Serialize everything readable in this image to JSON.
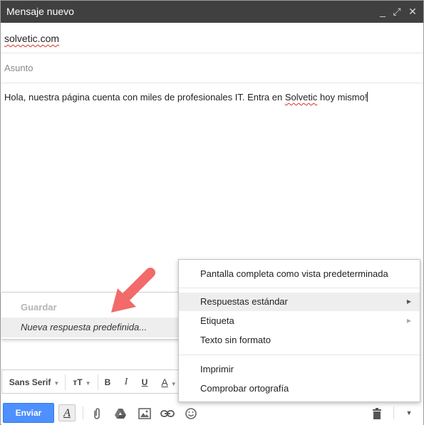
{
  "window": {
    "title": "Mensaje nuevo",
    "controls": {
      "minimize": "_",
      "popout": "⤢",
      "close": "✕"
    }
  },
  "compose": {
    "to": "solvetic.com",
    "subject_placeholder": "Asunto",
    "body_before": "Hola, nuestra página cuenta con miles de profesionales IT. Entra en ",
    "body_misspelled": "Solvetic",
    "body_after": " hoy mismo!"
  },
  "canned_submenu": {
    "save_label": "Guardar",
    "new_label": "Nueva respuesta predefinida..."
  },
  "formatting_toolbar": {
    "font": "Sans Serif",
    "size_icon": "тT",
    "bold": "B",
    "italic": "I",
    "underline": "U",
    "text_color": "A"
  },
  "send_toolbar": {
    "send_label": "Enviar",
    "format_toggle": "A"
  },
  "more_menu": {
    "items": [
      {
        "label": "Pantalla completa como vista predeterminada"
      },
      {
        "label": "Respuestas estándar"
      },
      {
        "label": "Etiqueta"
      },
      {
        "label": "Texto sin formato"
      },
      {
        "label": "Imprimir"
      },
      {
        "label": "Comprobar ortografía"
      }
    ]
  },
  "colors": {
    "titlebar": "#404040",
    "send_button": "#4d90fe",
    "annotation_arrow": "#f26a6a",
    "spellcheck_underline": "#d93025"
  }
}
